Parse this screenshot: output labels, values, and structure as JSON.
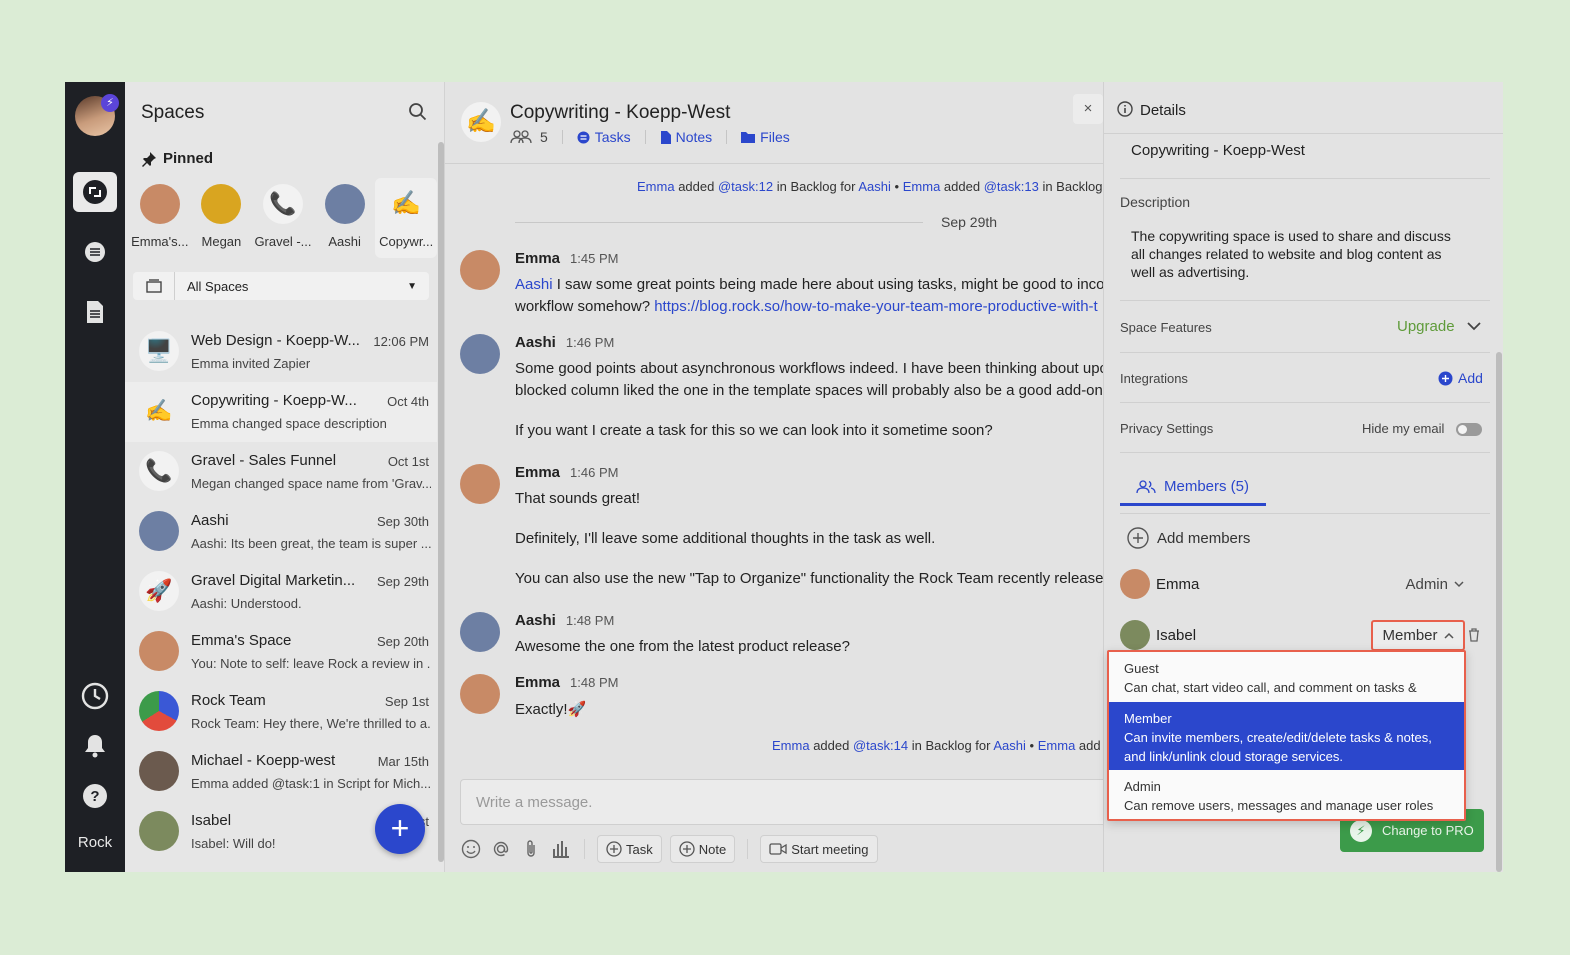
{
  "rail": {
    "badge": "⚡",
    "label": "Rock"
  },
  "spaces": {
    "title": "Spaces",
    "pinned_title": "Pinned",
    "pinned": [
      {
        "name": "Emma's...",
        "color": "#c88a66"
      },
      {
        "name": "Megan",
        "color": "#d9a520"
      },
      {
        "name": "Gravel -...",
        "glyph": "📞"
      },
      {
        "name": "Aashi",
        "color": "#6d7fa3"
      },
      {
        "name": "Copywr...",
        "glyph": "✍️"
      }
    ],
    "filter": "All Spaces",
    "items": [
      {
        "name": "Web Design - Koepp-W...",
        "time": "12:06 PM",
        "preview": "Emma invited Zapier",
        "glyph": "🖥️"
      },
      {
        "name": "Copywriting - Koepp-W...",
        "time": "Oct 4th",
        "preview": "Emma changed space description",
        "glyph": "✍️"
      },
      {
        "name": "Gravel - Sales Funnel",
        "time": "Oct 1st",
        "preview": "Megan changed space name from 'Grav...",
        "glyph": "📞"
      },
      {
        "name": "Aashi",
        "time": "Sep 30th",
        "preview": "Aashi: Its been great, the team is super ...",
        "color": "#6d7fa3"
      },
      {
        "name": "Gravel Digital Marketin...",
        "time": "Sep 29th",
        "preview": "Aashi: Understood.",
        "glyph": "🚀"
      },
      {
        "name": "Emma's Space",
        "time": "Sep 20th",
        "preview": "You: Note to self: leave Rock a review in ...",
        "color": "#c88a66"
      },
      {
        "name": "Rock Team",
        "time": "Sep 1st",
        "preview": "Rock Team: Hey there, We're thrilled to a...",
        "color": "#3a58d6"
      },
      {
        "name": "Michael - Koepp-west",
        "time": "Mar 15th",
        "preview": "Emma added @task:1 in Script for Mich...",
        "color": "#6b5a4e"
      },
      {
        "name": "Isabel",
        "time": "st",
        "preview": "Isabel: Will do!",
        "color": "#7c8a5e"
      }
    ],
    "fab": "+"
  },
  "chat": {
    "title": "Copywriting - Koepp-West",
    "emoji": "✍️",
    "member_count": "5",
    "tabs": [
      "Tasks",
      "Notes",
      "Files"
    ],
    "close": "×",
    "activity_top": {
      "who": "Emma",
      "a1": "added",
      "task": "@task:12",
      "a2": "in Backlog for",
      "for": "Aashi",
      "dot": "•",
      "who2": "Emma",
      "a3": "added",
      "task2": "@task:13",
      "a4": "in Backlog"
    },
    "date": "Sep 29th",
    "messages": [
      {
        "author": "Emma",
        "time": "1:45 PM",
        "color": "#c88a66"
      },
      {
        "author": "Aashi",
        "time": "1:46 PM",
        "color": "#6d7fa3"
      },
      {
        "author": "Emma",
        "time": "1:46 PM",
        "color": "#c88a66"
      },
      {
        "author": "Aashi",
        "time": "1:48 PM",
        "color": "#6d7fa3"
      },
      {
        "author": "Emma",
        "time": "1:48 PM",
        "color": "#c88a66"
      }
    ],
    "m1_mention": "Aashi",
    "m1_l1": " I saw some great points being made here about using tasks, might be good to inco",
    "m1_l2": "workflow somehow? ",
    "m1_link": "https://blog.rock.so/how-to-make-your-team-more-productive-with-t",
    "m2_l1": "Some good points about asynchronous workflows indeed. I have been thinking about upc",
    "m2_l2": "blocked column liked the one in the template spaces will probably also be a good add-on.",
    "m2_l3": "If you want I create a task for this so we can look into it sometime soon?",
    "m3_l1": "That sounds great!",
    "m3_l2": "Definitely, I'll leave some additional thoughts in the task as well.",
    "m3_l3": "You can also use the new \"Tap to Organize\" functionality the Rock Team recently released",
    "m4_l1": "Awesome the one from the latest product release?",
    "m5_l1": "Exactly!🚀",
    "activity_bottom": {
      "who": "Emma",
      "a1": "added",
      "task": "@task:14",
      "a2": "in Backlog for",
      "for": "Aashi",
      "dot": "•",
      "who2": "Emma",
      "a3": "add"
    },
    "compose_placeholder": "Write a message.",
    "tools": {
      "task": "Task",
      "note": "Note",
      "meeting": "Start meeting"
    }
  },
  "details": {
    "title": "Details",
    "name": "Copywriting - Koepp-West",
    "description_label": "Description",
    "description": "The copywriting space is used to share and discuss all changes related to website and blog content as well as advertising.",
    "features_label": "Space Features",
    "upgrade": "Upgrade",
    "integrations_label": "Integrations",
    "add": "Add",
    "privacy_label": "Privacy Settings",
    "hide_email": "Hide my email",
    "members_tab": "Members (5)",
    "add_members": "Add members",
    "members": [
      {
        "name": "Emma",
        "role": "Admin",
        "color": "#c88a66"
      },
      {
        "name": "Isabel",
        "role": "Member",
        "color": "#7c8a5e"
      }
    ],
    "pro_button": "Change to PRO",
    "accent": "#2b47cc",
    "upgrade_color": "#5f9b3a"
  },
  "role_menu": [
    {
      "title": "Guest",
      "desc": "Can chat, start video call, and comment on tasks & notes."
    },
    {
      "title": "Member",
      "desc": "Can invite members, create/edit/delete tasks & notes,",
      "desc2": "and link/unlink cloud storage services."
    },
    {
      "title": "Admin",
      "desc": "Can remove users, messages and manage user roles"
    }
  ]
}
